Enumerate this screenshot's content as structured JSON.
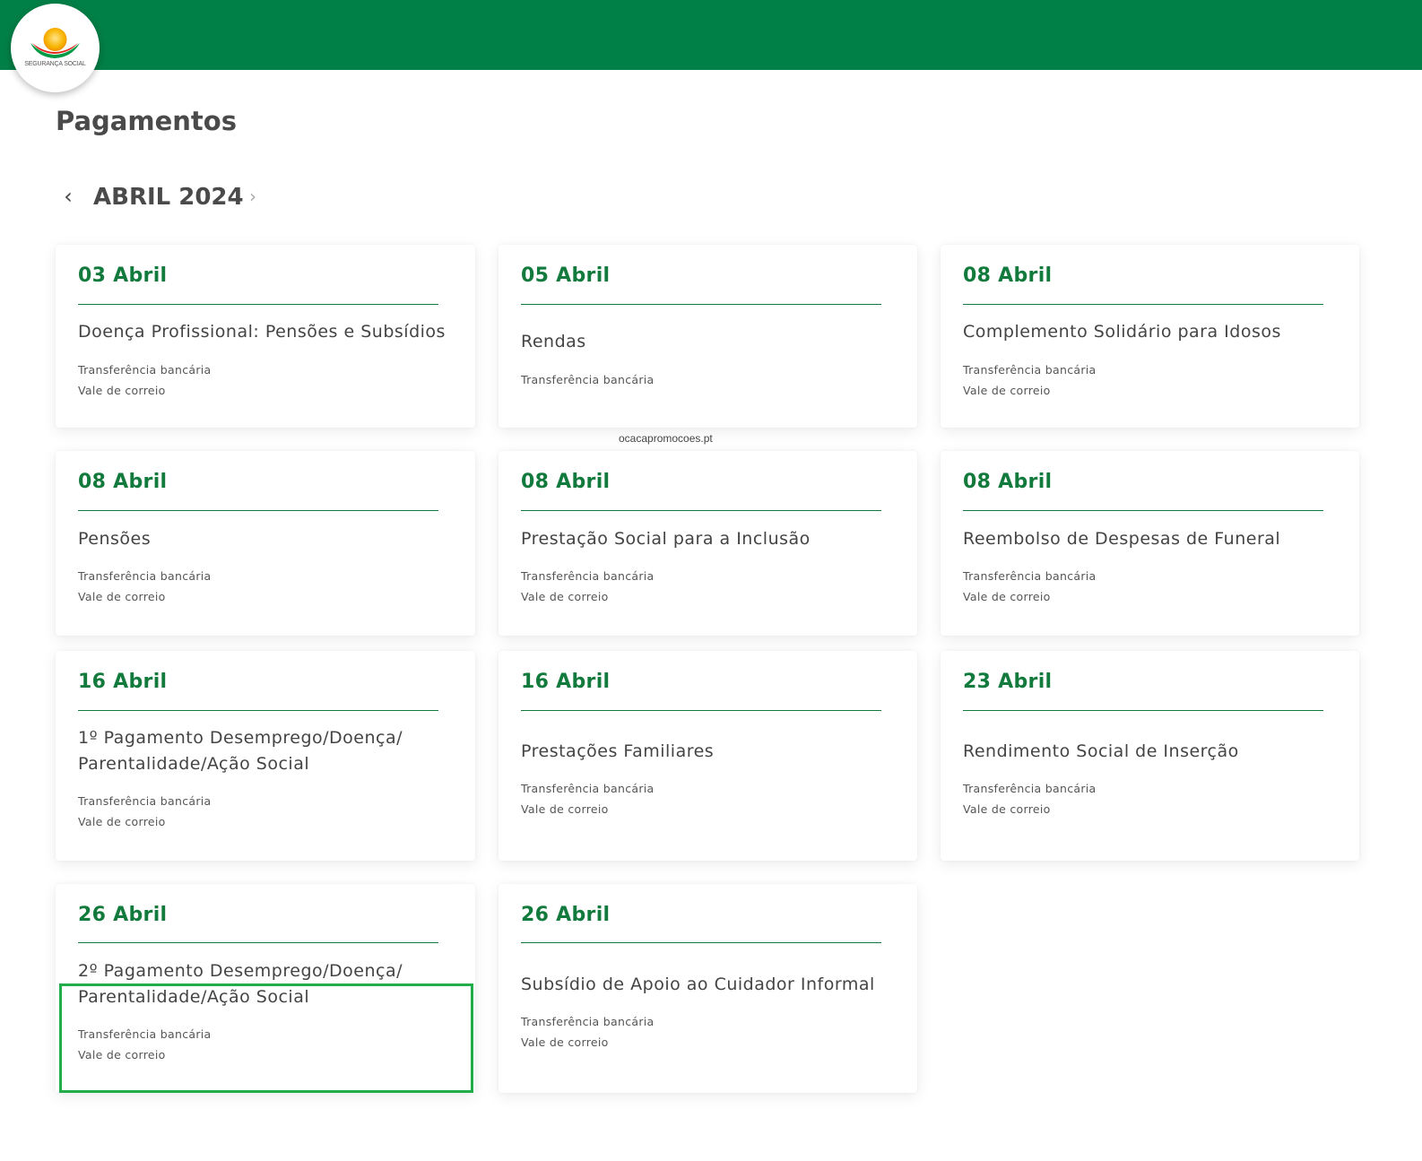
{
  "brand": {
    "logo_text": "SEGURANÇA SOCIAL"
  },
  "page": {
    "title": "Pagamentos"
  },
  "month_nav": {
    "label": "ABRIL 2024",
    "prev_icon": "‹",
    "next_icon": "›"
  },
  "watermark": "ocacapromocoes.pt",
  "colors": {
    "topbar": "#007f46",
    "accent": "#127a3c",
    "focus": "#20ad4a"
  },
  "cards": [
    {
      "date": "03 Abril",
      "title": "Doença Profissional: Pensões e Subsídios",
      "methods": [
        "Transferência bancária",
        "Vale de correio"
      ]
    },
    {
      "date": "05 Abril",
      "title": "Rendas",
      "methods": [
        "Transferência bancária"
      ]
    },
    {
      "date": "08 Abril",
      "title": "Complemento Solidário para Idosos",
      "methods": [
        "Transferência bancária",
        "Vale de correio"
      ]
    },
    {
      "date": "08 Abril",
      "title": "Pensões",
      "methods": [
        "Transferência bancária",
        "Vale de correio"
      ]
    },
    {
      "date": "08 Abril",
      "title": "Prestação Social para a Inclusão",
      "methods": [
        "Transferência bancária",
        "Vale de correio"
      ]
    },
    {
      "date": "08 Abril",
      "title": "Reembolso de Despesas de Funeral",
      "methods": [
        "Transferência bancária",
        "Vale de correio"
      ]
    },
    {
      "date": "16 Abril",
      "title": "1º Pagamento Desemprego/Doença/ Parentalidade/Ação Social",
      "methods": [
        "Transferência bancária",
        "Vale de correio"
      ]
    },
    {
      "date": "16 Abril",
      "title": "Prestações Familiares",
      "methods": [
        "Transferência bancária",
        "Vale de correio"
      ]
    },
    {
      "date": "23 Abril",
      "title": "Rendimento Social de Inserção",
      "methods": [
        "Transferência bancária",
        "Vale de correio"
      ]
    },
    {
      "date": "26 Abril",
      "title": "2º Pagamento Desemprego/Doença/ Parentalidade/Ação Social",
      "methods": [
        "Transferência bancária",
        "Vale de correio"
      ]
    },
    {
      "date": "26 Abril",
      "title": "Subsídio de Apoio ao Cuidador Informal",
      "methods": [
        "Transferência bancária",
        "Vale de correio"
      ]
    }
  ]
}
